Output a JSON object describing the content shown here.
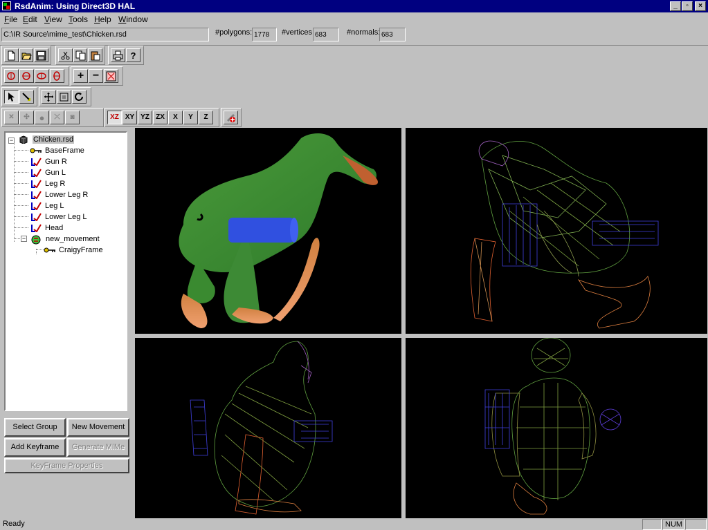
{
  "window": {
    "title": "RsdAnim: Using Direct3D HAL"
  },
  "menu": [
    {
      "label": "File",
      "accel": "F"
    },
    {
      "label": "Edit",
      "accel": "E"
    },
    {
      "label": "View",
      "accel": "V"
    },
    {
      "label": "Tools",
      "accel": "T"
    },
    {
      "label": "Help",
      "accel": "H"
    },
    {
      "label": "Window",
      "accel": "W"
    }
  ],
  "info": {
    "path": "C:\\IR Source\\mime_test\\Chicken.rsd",
    "polygons_label": "#polygons:",
    "polygons_value": "1778",
    "vertices_label": "#vertices:",
    "vertices_value": "683",
    "normals_label": "#normals:",
    "normals_value": "683"
  },
  "axis_buttons": [
    "XZ",
    "XY",
    "YZ",
    "ZX",
    "X",
    "Y",
    "Z"
  ],
  "tree": [
    {
      "label": "Chicken.rsd",
      "icon": "model-cube-icon"
    },
    {
      "label": "BaseFrame",
      "icon": "key-icon"
    },
    {
      "label": "Gun R",
      "icon": "bone-icon"
    },
    {
      "label": "Gun L",
      "icon": "bone-icon"
    },
    {
      "label": "Leg R",
      "icon": "bone-icon"
    },
    {
      "label": "Lower Leg R",
      "icon": "bone-icon"
    },
    {
      "label": "Leg L",
      "icon": "bone-icon"
    },
    {
      "label": "Lower Leg L",
      "icon": "bone-icon"
    },
    {
      "label": "Head",
      "icon": "bone-icon"
    },
    {
      "label": "new_movement",
      "icon": "movement-icon"
    },
    {
      "label": "CraigyFrame",
      "icon": "key-icon"
    }
  ],
  "buttons": {
    "select_group": "Select Group",
    "new_movement": "New Movement",
    "add_keyframe": "Add Keyframe",
    "generate_mime": "Generate MIMe",
    "keyframe_properties": "KeyFrame Properties"
  },
  "status": {
    "text": "Ready",
    "num": "NUM"
  },
  "colors": {
    "title_bar": "#000080",
    "face": "#c0c0c0",
    "viewport_bg": "#000000"
  }
}
